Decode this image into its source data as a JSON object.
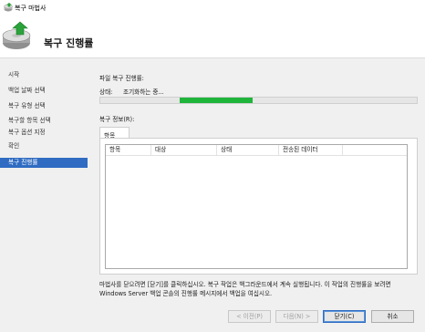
{
  "window": {
    "title": "복구 마법사"
  },
  "header": {
    "title": "복구 진행률"
  },
  "sidebar": {
    "items": [
      {
        "label": "시작"
      },
      {
        "label": "백업 날짜 선택"
      },
      {
        "label": "복구 유형 선택"
      },
      {
        "label": "복구할 항목 선택"
      },
      {
        "label": "복구 옵션 지정"
      },
      {
        "label": "확인"
      },
      {
        "label": "복구 진행률",
        "active": true
      }
    ]
  },
  "main": {
    "progress_title": "파일 복구 진행률:",
    "status_label": "상태:",
    "status_value": "조기화하는 중...",
    "progress_fraction_start": 0.25,
    "progress_fraction_end": 0.48,
    "progress_color": "#1fb53b",
    "info_label": "복구 정보(R):",
    "tab_label": "항목",
    "columns": [
      "항목",
      "대상",
      "상태",
      "전송된 데이터"
    ],
    "rows": [],
    "info_text": "마법사를 닫으려면 [닫기]를 클릭하십시오. 복구 작업은 백그라운드에서 계속 실행됩니다. 이 작업의 진행률을 보려면 Windows Server 백업 콘솔의 진행률 메시지에서 백업을 여십시오."
  },
  "buttons": {
    "prev": "< 이전(P)",
    "next": "다음(N) >",
    "close": "닫기(C)",
    "cancel": "취소"
  },
  "colors": {
    "accent": "#2f6cc2"
  }
}
